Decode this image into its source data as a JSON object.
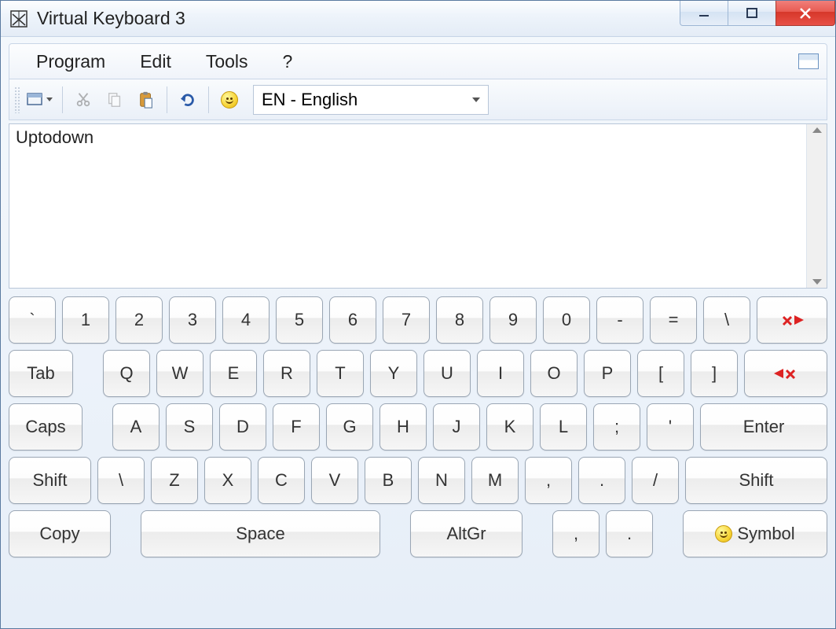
{
  "window": {
    "title": "Virtual Keyboard 3"
  },
  "menu": {
    "program": "Program",
    "edit": "Edit",
    "tools": "Tools",
    "help": "?"
  },
  "toolbar": {
    "language": "EN - English"
  },
  "editor": {
    "text": "Uptodown"
  },
  "keys": {
    "row1": [
      "`",
      "1",
      "2",
      "3",
      "4",
      "5",
      "6",
      "7",
      "8",
      "9",
      "0",
      "-",
      "=",
      "\\"
    ],
    "tab": "Tab",
    "row2": [
      "Q",
      "W",
      "E",
      "R",
      "T",
      "Y",
      "U",
      "I",
      "O",
      "P",
      "[",
      "]"
    ],
    "caps": "Caps",
    "row3": [
      "A",
      "S",
      "D",
      "F",
      "G",
      "H",
      "J",
      "K",
      "L",
      ";",
      "'"
    ],
    "enter": "Enter",
    "shift": "Shift",
    "row4": [
      "\\",
      "Z",
      "X",
      "C",
      "V",
      "B",
      "N",
      "M",
      ",",
      ".",
      "/"
    ],
    "copy": "Copy",
    "space": "Space",
    "altgr": "AltGr",
    "comma": ",",
    "period": ".",
    "symbol": "Symbol"
  }
}
